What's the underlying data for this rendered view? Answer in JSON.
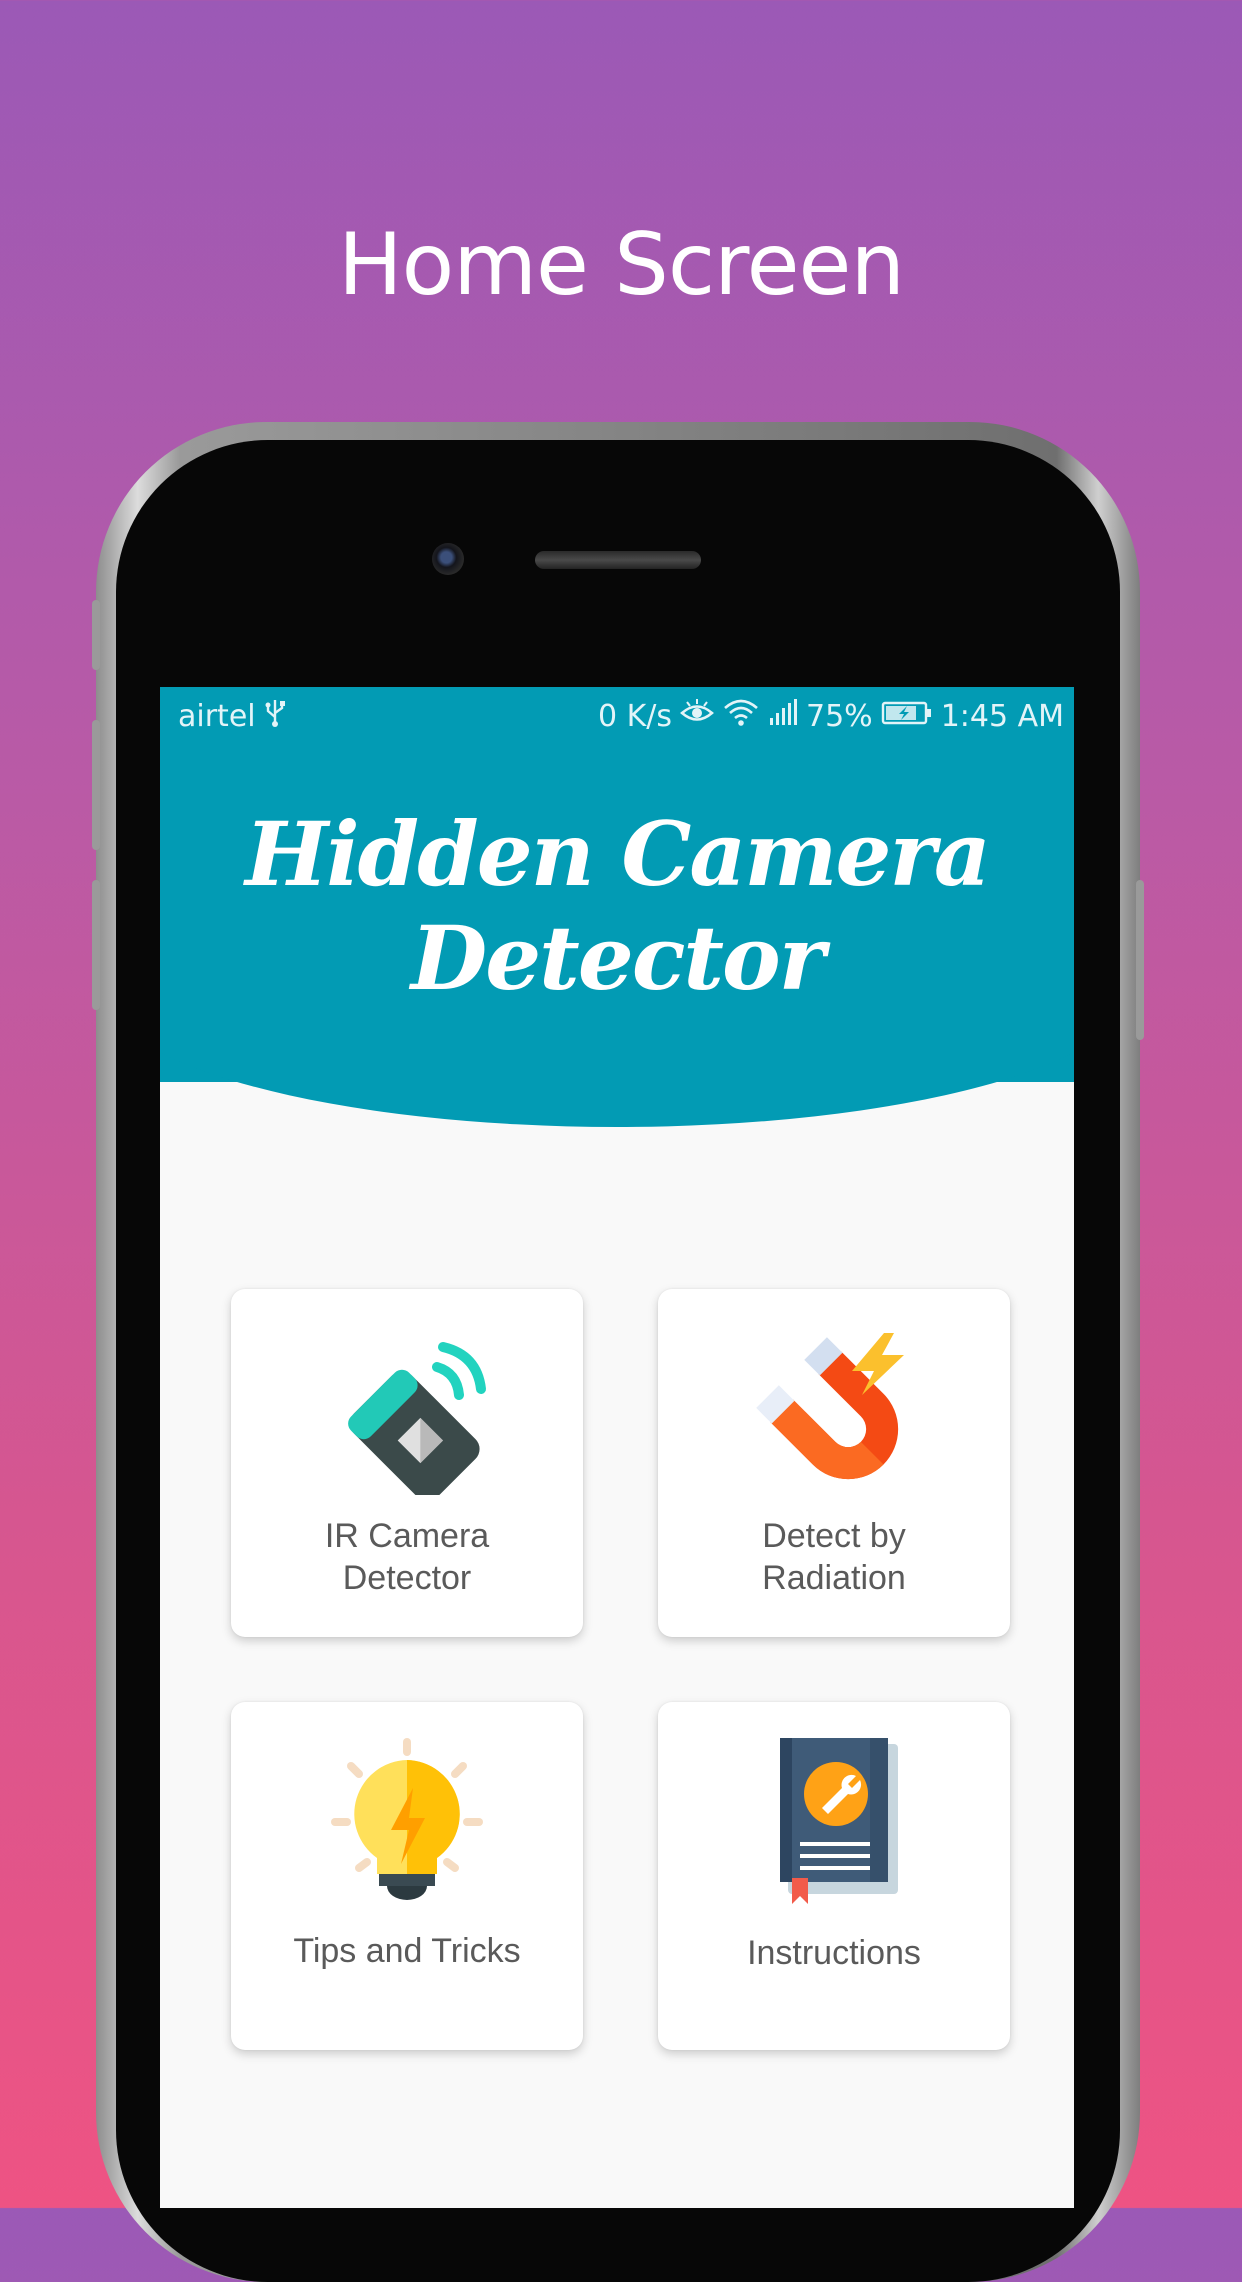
{
  "promo": {
    "title": "Home Screen"
  },
  "statusbar": {
    "carrier": "airtel",
    "usb_icon": "usb-icon",
    "speed": "0 K/s",
    "eye_icon": "eye-icon",
    "wifi_icon": "wifi-icon",
    "signal_icon": "signal-icon",
    "battery": "75%",
    "battery_icon": "battery-charging-icon",
    "time": "1:45 AM"
  },
  "app": {
    "title_line1": "Hidden Camera",
    "title_line2": "Detector",
    "header_color": "#029bb4"
  },
  "menu": [
    {
      "label_line1": "IR Camera",
      "label_line2": "Detector",
      "icon": "ir-remote-icon"
    },
    {
      "label_line1": "Detect by",
      "label_line2": "Radiation",
      "icon": "magnet-icon"
    },
    {
      "label_line1": "Tips and Tricks",
      "label_line2": "",
      "icon": "lightbulb-icon"
    },
    {
      "label_line1": "Instructions",
      "label_line2": "",
      "icon": "manual-book-icon"
    }
  ]
}
